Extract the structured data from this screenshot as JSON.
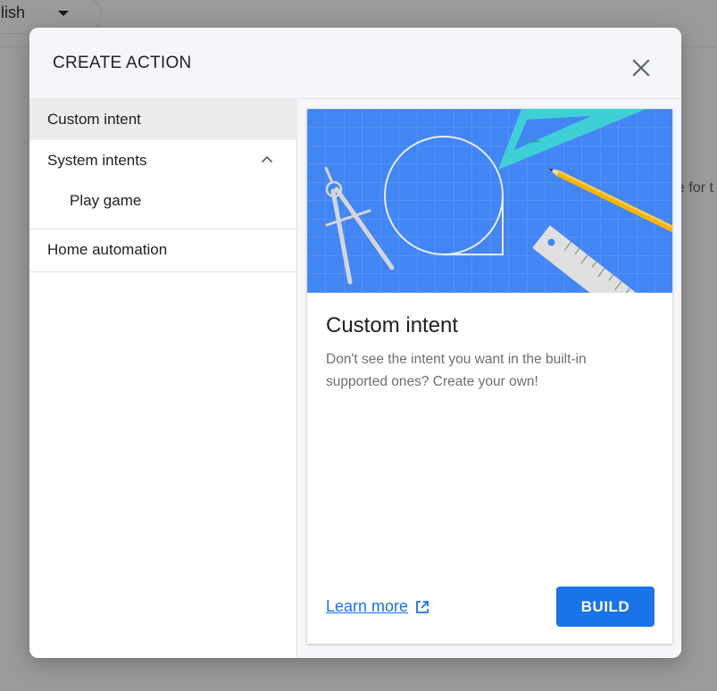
{
  "background": {
    "language_select_value": "nglish",
    "text_fragment": "e for t"
  },
  "dialog": {
    "title": "CREATE ACTION",
    "close_icon": "close-icon"
  },
  "sidebar": {
    "items": [
      {
        "label": "Custom intent",
        "selected": true
      },
      {
        "label": "System intents",
        "expanded": true,
        "icon": "chevron-up-icon"
      },
      {
        "label": "Play game",
        "indent": true
      },
      {
        "label": "Home automation"
      }
    ]
  },
  "card": {
    "illustration": "blueprint-illustration",
    "title": "Custom intent",
    "description": "Don't see the intent you want in the built-in supported ones? Create your own!",
    "learn_more_label": "Learn more",
    "learn_more_icon": "open-in-new-icon",
    "build_label": "BUILD"
  },
  "colors": {
    "accent": "#1a73e8",
    "blueprint": "#4285f4",
    "header_bg": "#f4f6f9",
    "selected_bg": "#ececec"
  }
}
